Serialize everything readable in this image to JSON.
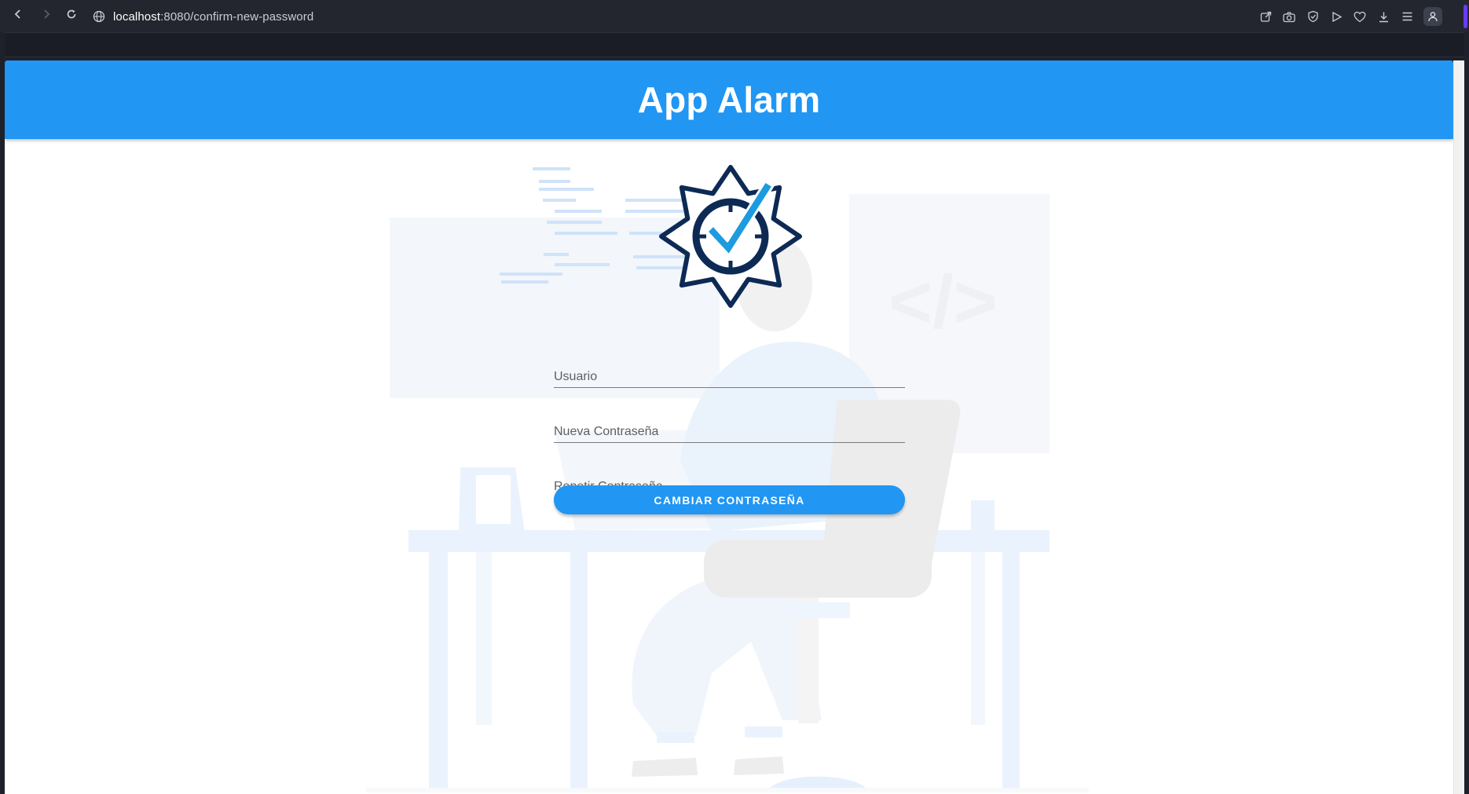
{
  "browser": {
    "url_host": "localhost",
    "url_path": ":8080/confirm-new-password",
    "icons": [
      "back-icon",
      "forward-icon",
      "reload-icon",
      "globe-icon",
      "share-icon",
      "camera-icon",
      "shield-icon",
      "play-icon",
      "heart-icon",
      "download-icon",
      "menu-icon",
      "profile-icon"
    ]
  },
  "app": {
    "title": "App Alarm",
    "logo_icon": "alarm-check-badge-icon"
  },
  "form": {
    "usuario_placeholder": "Usuario",
    "nueva_placeholder": "Nueva Contraseña",
    "repetir_placeholder": "Repetir Contraseña",
    "submit_label": "CAMBIAR CONTRASEÑA"
  },
  "colors": {
    "primary": "#2196f3",
    "logo_navy": "#0d2a55",
    "logo_check": "#1c9be0",
    "chrome_bg": "#23262f"
  }
}
